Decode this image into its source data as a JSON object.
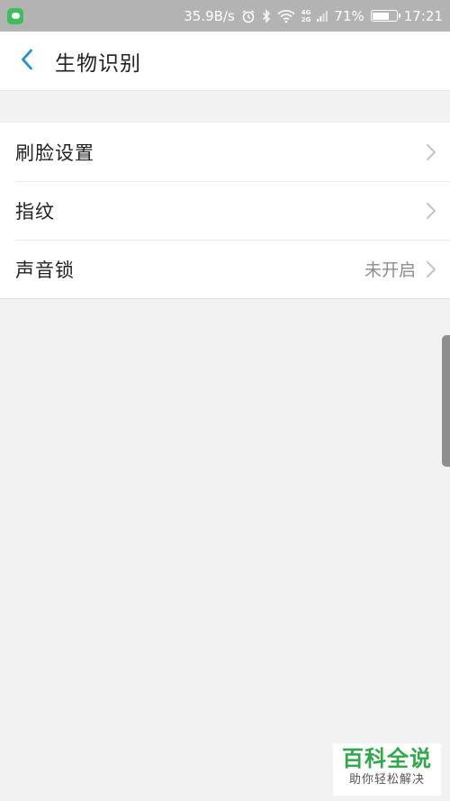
{
  "status_bar": {
    "network_speed": "35.9B/s",
    "network_badge_top": "4G",
    "network_badge_bottom": "2G",
    "battery_percent": "71%",
    "battery_level": 0.71,
    "time": "17:21",
    "icons": [
      "message-app-icon",
      "alarm-icon",
      "bluetooth-icon",
      "wifi-icon",
      "signal-icon",
      "battery-icon"
    ]
  },
  "app_bar": {
    "title": "生物识别",
    "back_icon": "chevron-left-icon",
    "accent_color": "#1a8fe3"
  },
  "settings": {
    "items": [
      {
        "label": "刷脸设置",
        "value": ""
      },
      {
        "label": "指纹",
        "value": ""
      },
      {
        "label": "声音锁",
        "value": "未开启"
      }
    ]
  },
  "watermark": {
    "title": "百科全说",
    "subtitle": "助你轻松解决",
    "color": "#2fa84a"
  }
}
